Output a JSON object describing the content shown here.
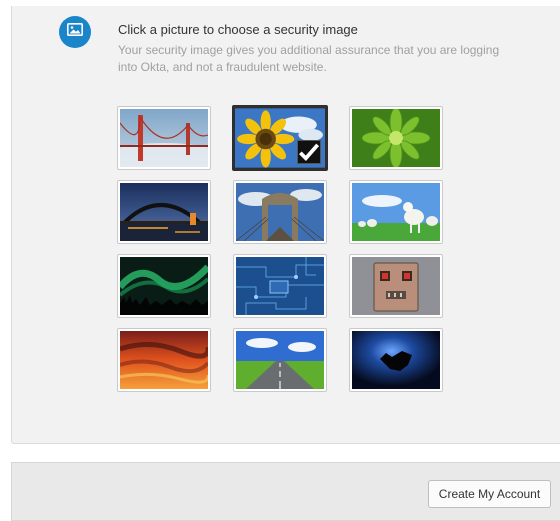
{
  "header": {
    "icon": "image-icon",
    "title": "Click a picture to choose a security image",
    "description": "Your security image gives you additional assurance that you are logging into Okta, and not a fraudulent website."
  },
  "images": [
    {
      "name": "golden-gate-bridge",
      "selected": false
    },
    {
      "name": "sunflower",
      "selected": true
    },
    {
      "name": "green-succulent",
      "selected": false
    },
    {
      "name": "harbour-bridge-night",
      "selected": false
    },
    {
      "name": "brooklyn-bridge",
      "selected": false
    },
    {
      "name": "lambs-field",
      "selected": false
    },
    {
      "name": "aurora",
      "selected": false
    },
    {
      "name": "circuit-board",
      "selected": false
    },
    {
      "name": "robot-toy",
      "selected": false
    },
    {
      "name": "sunset-clouds",
      "selected": false
    },
    {
      "name": "open-road",
      "selected": false
    },
    {
      "name": "eclipse-bat",
      "selected": false
    }
  ],
  "footer": {
    "create_account_label": "Create My Account"
  },
  "colors": {
    "accent": "#1a85c8",
    "selected_tile": "#2f2f2f"
  }
}
